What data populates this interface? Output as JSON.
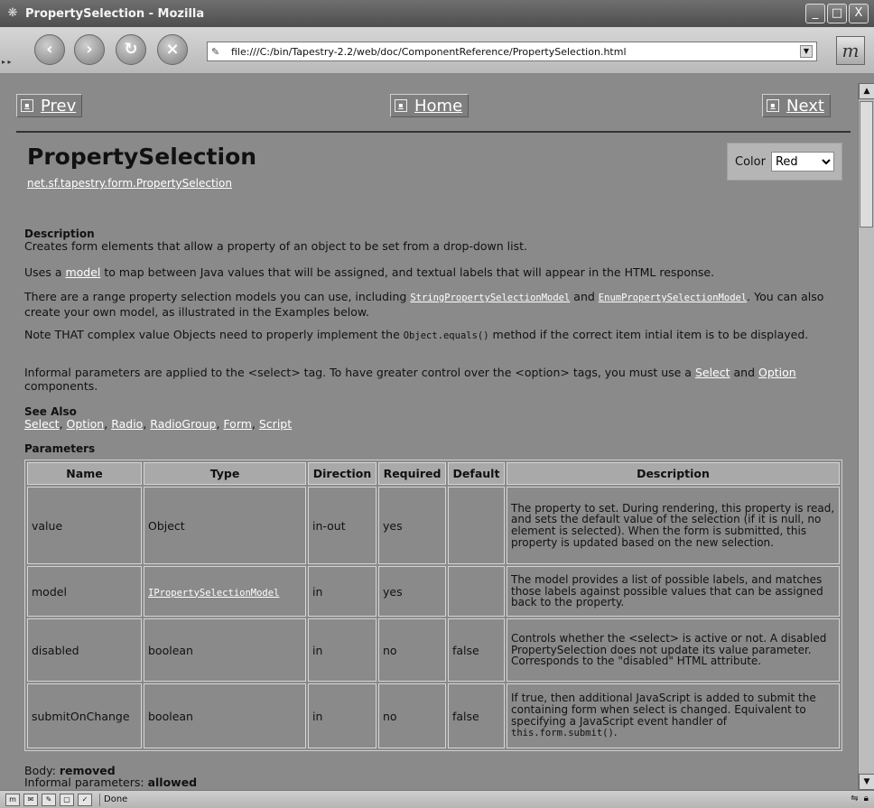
{
  "window": {
    "title": "PropertySelection - Mozilla",
    "minimize": "_",
    "maximize": "□",
    "close": "X"
  },
  "toolbar": {
    "back": "‹",
    "forward": "›",
    "reload": "↻",
    "stop": "×",
    "url": "file:///C:/bin/Tapestry-2.2/web/doc/ComponentReference/PropertySelection.html",
    "logo": "m"
  },
  "nav": {
    "prev": "Prev",
    "home": "Home",
    "next": "Next"
  },
  "component": {
    "title": "PropertySelection",
    "class_name": "net.sf.tapestry.form.PropertySelection"
  },
  "color_selector": {
    "label": "Color",
    "value": "Red"
  },
  "description": {
    "heading": "Description",
    "line1": "Creates form elements that allow a property of an object to be set from a drop-down list.",
    "p2_pre": "Uses a ",
    "p2_link": "model",
    "p2_post": " to map between Java values that will be assigned, and textual labels that will appear in the HTML response.",
    "p3_pre": "There are a range property selection models you can use, including ",
    "p3_link1": "StringPropertySelectionModel",
    "p3_mid": " and ",
    "p3_link2": "EnumPropertySelectionModel",
    "p3_post": ". You can also create your own model, as illustrated in the Examples below.",
    "p4_pre": "Note THAT complex value Objects need to properly implement the ",
    "p4_code": "Object.equals()",
    "p4_post": " method if the correct item intial item is to be displayed.",
    "p5_pre": "Informal parameters are applied to the <select> tag.  To have greater control over the <option> tags, you must use a ",
    "p5_link1": "Select",
    "p5_mid": " and ",
    "p5_link2": "Option",
    "p5_post": " components."
  },
  "see_also": {
    "heading": "See Also",
    "links": [
      "Select",
      "Option",
      "Radio",
      "RadioGroup",
      "Form",
      "Script"
    ]
  },
  "parameters": {
    "heading": "Parameters",
    "columns": [
      "Name",
      "Type",
      "Direction",
      "Required",
      "Default",
      "Description"
    ],
    "rows": [
      {
        "name": "value",
        "type": "Object",
        "direction": "in-out",
        "required": "yes",
        "default": "",
        "description": "The property to set. During rendering, this property is read, and sets the default value of the selection (if it is null, no element is selected). When the form is submitted, this property is updated based on the new selection."
      },
      {
        "name": "model",
        "type": "IPropertySelectionModel",
        "direction": "in",
        "required": "yes",
        "default": "",
        "description": "The model provides a list of possible labels, and matches those labels against possible values that can be assigned back to the property."
      },
      {
        "name": "disabled",
        "type": "boolean",
        "direction": "in",
        "required": "no",
        "default": "false",
        "description": "Controls whether the <select> is active or not. A disabled PropertySelection does not update its value parameter. Corresponds to the \"disabled\" HTML attribute."
      },
      {
        "name": "submitOnChange",
        "type": "boolean",
        "direction": "in",
        "required": "no",
        "default": "false",
        "description_pre": "If true, then additional JavaScript is added to submit the containing form when select is changed. Equivalent to specifying a JavaScript event handler of ",
        "description_code": "this.form.submit()",
        "description_post": "."
      }
    ]
  },
  "footer": {
    "body_label": "Body: ",
    "body_value": "removed",
    "informal_label": "Informal parameters: ",
    "informal_value": "allowed"
  },
  "status": {
    "text": "Done"
  }
}
